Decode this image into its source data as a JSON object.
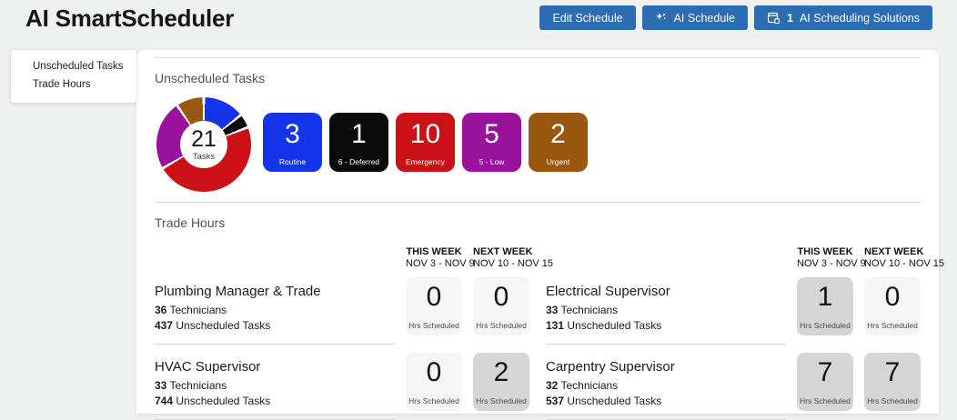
{
  "app": {
    "title": "AI SmartScheduler"
  },
  "header": {
    "buttons": [
      {
        "label": "Edit Schedule"
      },
      {
        "label": "AI Schedule",
        "icon": "sparkle-icon"
      },
      {
        "label": "AI Scheduling Solutions",
        "count": "1",
        "icon": "calendar-sync-icon"
      }
    ],
    "button_color": "#2b6cb3"
  },
  "sidebar": {
    "items": [
      {
        "label": "Unscheduled Tasks"
      },
      {
        "label": "Trade Hours"
      }
    ]
  },
  "unscheduled_tasks": {
    "section_title": "Unscheduled Tasks",
    "donut": {
      "center_value": "21",
      "center_label": "Tasks"
    },
    "tiles": [
      {
        "value": "3",
        "label": "Routine",
        "color": "#1434ec"
      },
      {
        "value": "1",
        "label": "6 - Deferred",
        "color": "#0b0b0b"
      },
      {
        "value": "10",
        "label": "Emergency",
        "color": "#cb1016"
      },
      {
        "value": "5",
        "label": "5 - Low",
        "color": "#9a119c"
      },
      {
        "value": "2",
        "label": "Urgent",
        "color": "#9a570f"
      }
    ]
  },
  "chart_data": {
    "type": "pie",
    "style": "donut",
    "title": "Unscheduled Tasks",
    "categories": [
      "Routine",
      "6 - Deferred",
      "Emergency",
      "5 - Low",
      "Urgent"
    ],
    "values": [
      3,
      1,
      10,
      5,
      2
    ],
    "colors": [
      "#1434ec",
      "#0b0b0b",
      "#cb1016",
      "#9a119c",
      "#9a570f"
    ],
    "total": 21,
    "center_label": "21 Tasks",
    "legend_position": "right-tiles"
  },
  "trade_hours": {
    "section_title": "Trade Hours",
    "week_headers": [
      {
        "title": "THIS WEEK",
        "dates": "NOV 3 - NOV 9"
      },
      {
        "title": "NEXT WEEK",
        "dates": "NOV 10 - NOV 15"
      }
    ],
    "hrs_label": "Hrs Scheduled",
    "technicians_label": "Technicians",
    "tasks_label": "Unscheduled Tasks",
    "trades": [
      {
        "name": "Plumbing Manager & Trade",
        "technicians": "36",
        "unscheduled_tasks": "437",
        "this_week_hrs": "0",
        "next_week_hrs": "0",
        "this_week_highlight": false,
        "next_week_highlight": false,
        "column": "left"
      },
      {
        "name": "Electrical Supervisor",
        "technicians": "33",
        "unscheduled_tasks": "131",
        "this_week_hrs": "1",
        "next_week_hrs": "0",
        "this_week_highlight": true,
        "next_week_highlight": false,
        "column": "right"
      },
      {
        "name": "HVAC Supervisor",
        "technicians": "33",
        "unscheduled_tasks": "744",
        "this_week_hrs": "0",
        "next_week_hrs": "2",
        "this_week_highlight": false,
        "next_week_highlight": true,
        "column": "left"
      },
      {
        "name": "Carpentry Supervisor",
        "technicians": "32",
        "unscheduled_tasks": "537",
        "this_week_hrs": "7",
        "next_week_hrs": "7",
        "this_week_highlight": true,
        "next_week_highlight": true,
        "column": "right"
      }
    ]
  }
}
